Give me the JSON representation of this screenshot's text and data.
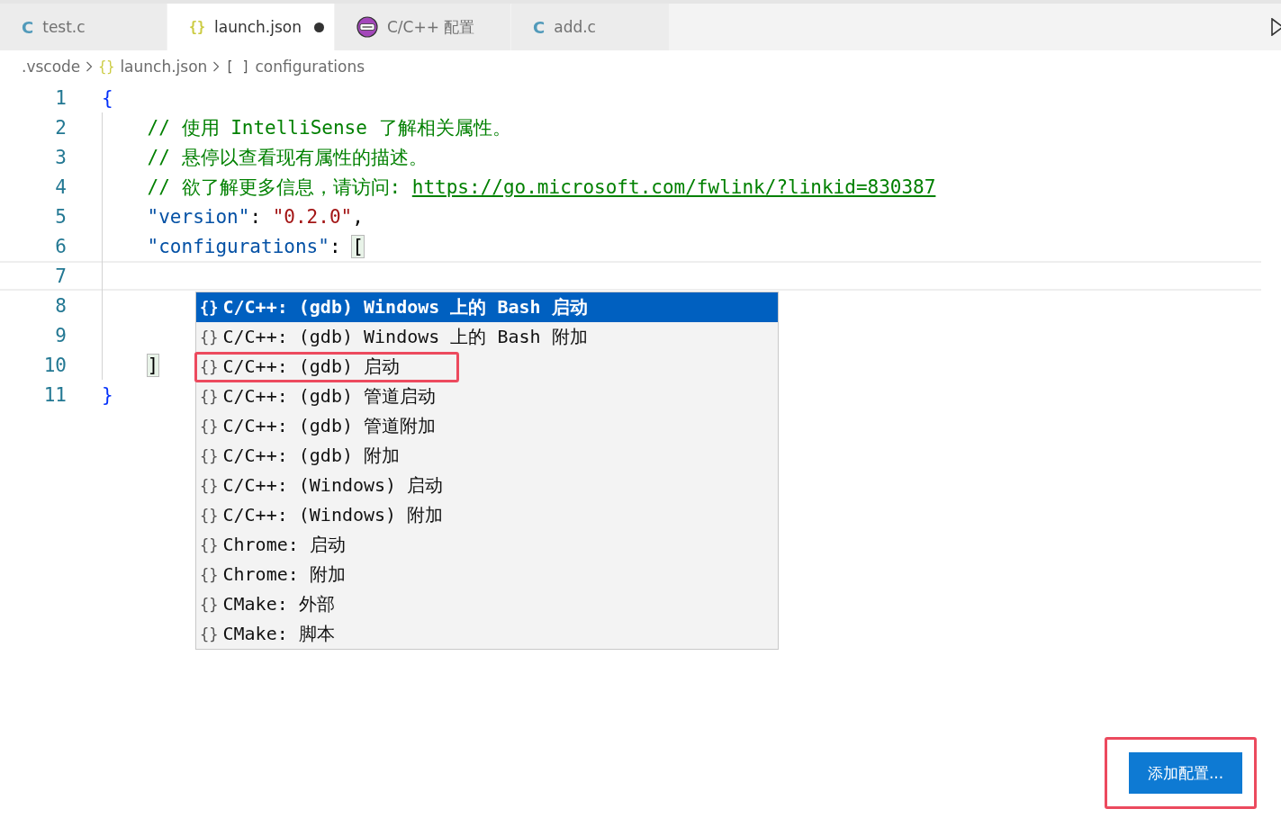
{
  "tabs": [
    {
      "kind": "c",
      "icon": "C",
      "label": "test.c",
      "selected": false,
      "dirty": false
    },
    {
      "kind": "json",
      "icon": "{}",
      "label": "launch.json",
      "selected": true,
      "dirty": true
    },
    {
      "kind": "settings",
      "label": "C/C++ 配置",
      "selected": false,
      "dirty": false
    },
    {
      "kind": "c",
      "icon": "C",
      "label": "add.c",
      "selected": false,
      "dirty": false
    }
  ],
  "breadcrumb": [
    {
      "kind": "folder",
      "label": ".vscode"
    },
    {
      "kind": "json",
      "icon": "{}",
      "label": "launch.json"
    },
    {
      "kind": "array",
      "icon": "[ ]",
      "label": "configurations"
    }
  ],
  "editor": {
    "lines": [
      {
        "number": "1",
        "tokens": [
          {
            "kind": "brace",
            "text": "{"
          }
        ]
      },
      {
        "number": "2",
        "tokens": [
          {
            "kind": "comment",
            "text": "    // 使用 IntelliSense 了解相关属性。"
          }
        ]
      },
      {
        "number": "3",
        "tokens": [
          {
            "kind": "comment",
            "text": "    // 悬停以查看现有属性的描述。"
          }
        ]
      },
      {
        "number": "4",
        "tokens": [
          {
            "kind": "comment",
            "text": "    // 欲了解更多信息，请访问: "
          },
          {
            "kind": "link",
            "text": "https://go.microsoft.com/fwlink/?linkid=830387"
          }
        ]
      },
      {
        "number": "5",
        "tokens": [
          {
            "kind": "key",
            "text": "    \"version\""
          },
          {
            "kind": "punct",
            "text": ": "
          },
          {
            "kind": "string",
            "text": "\"0.2.0\""
          },
          {
            "kind": "punct",
            "text": ","
          }
        ]
      },
      {
        "number": "6",
        "tokens": [
          {
            "kind": "key",
            "text": "    \"configurations\""
          },
          {
            "kind": "punct",
            "text": ": "
          },
          {
            "kind": "match",
            "text": "["
          }
        ]
      },
      {
        "number": "7",
        "current": true
      },
      {
        "number": "8"
      },
      {
        "number": "9"
      },
      {
        "number": "10",
        "tokens": [
          {
            "kind": "match",
            "text": "    ]"
          }
        ]
      },
      {
        "number": "11",
        "tokens": [
          {
            "kind": "brace",
            "text": "}"
          }
        ]
      }
    ]
  },
  "suggestions": [
    {
      "icon": "{}",
      "label": "C/C++: (gdb) Windows 上的 Bash 启动",
      "selected": true,
      "annotated": false
    },
    {
      "icon": "{}",
      "label": "C/C++: (gdb) Windows 上的 Bash 附加",
      "selected": false,
      "annotated": false
    },
    {
      "icon": "{}",
      "label": "C/C++: (gdb) 启动",
      "selected": false,
      "annotated": true
    },
    {
      "icon": "{}",
      "label": "C/C++: (gdb) 管道启动",
      "selected": false,
      "annotated": false
    },
    {
      "icon": "{}",
      "label": "C/C++: (gdb) 管道附加",
      "selected": false,
      "annotated": false
    },
    {
      "icon": "{}",
      "label": "C/C++: (gdb) 附加",
      "selected": false,
      "annotated": false
    },
    {
      "icon": "{}",
      "label": "C/C++: (Windows) 启动",
      "selected": false,
      "annotated": false
    },
    {
      "icon": "{}",
      "label": "C/C++: (Windows) 附加",
      "selected": false,
      "annotated": false
    },
    {
      "icon": "{}",
      "label": "Chrome: 启动",
      "selected": false,
      "annotated": false
    },
    {
      "icon": "{}",
      "label": "Chrome: 附加",
      "selected": false,
      "annotated": false
    },
    {
      "icon": "{}",
      "label": "CMake: 外部",
      "selected": false,
      "annotated": false
    },
    {
      "icon": "{}",
      "label": "CMake: 脚本",
      "selected": false,
      "annotated": false
    }
  ],
  "add_button": {
    "label": "添加配置...",
    "annotated": true
  }
}
